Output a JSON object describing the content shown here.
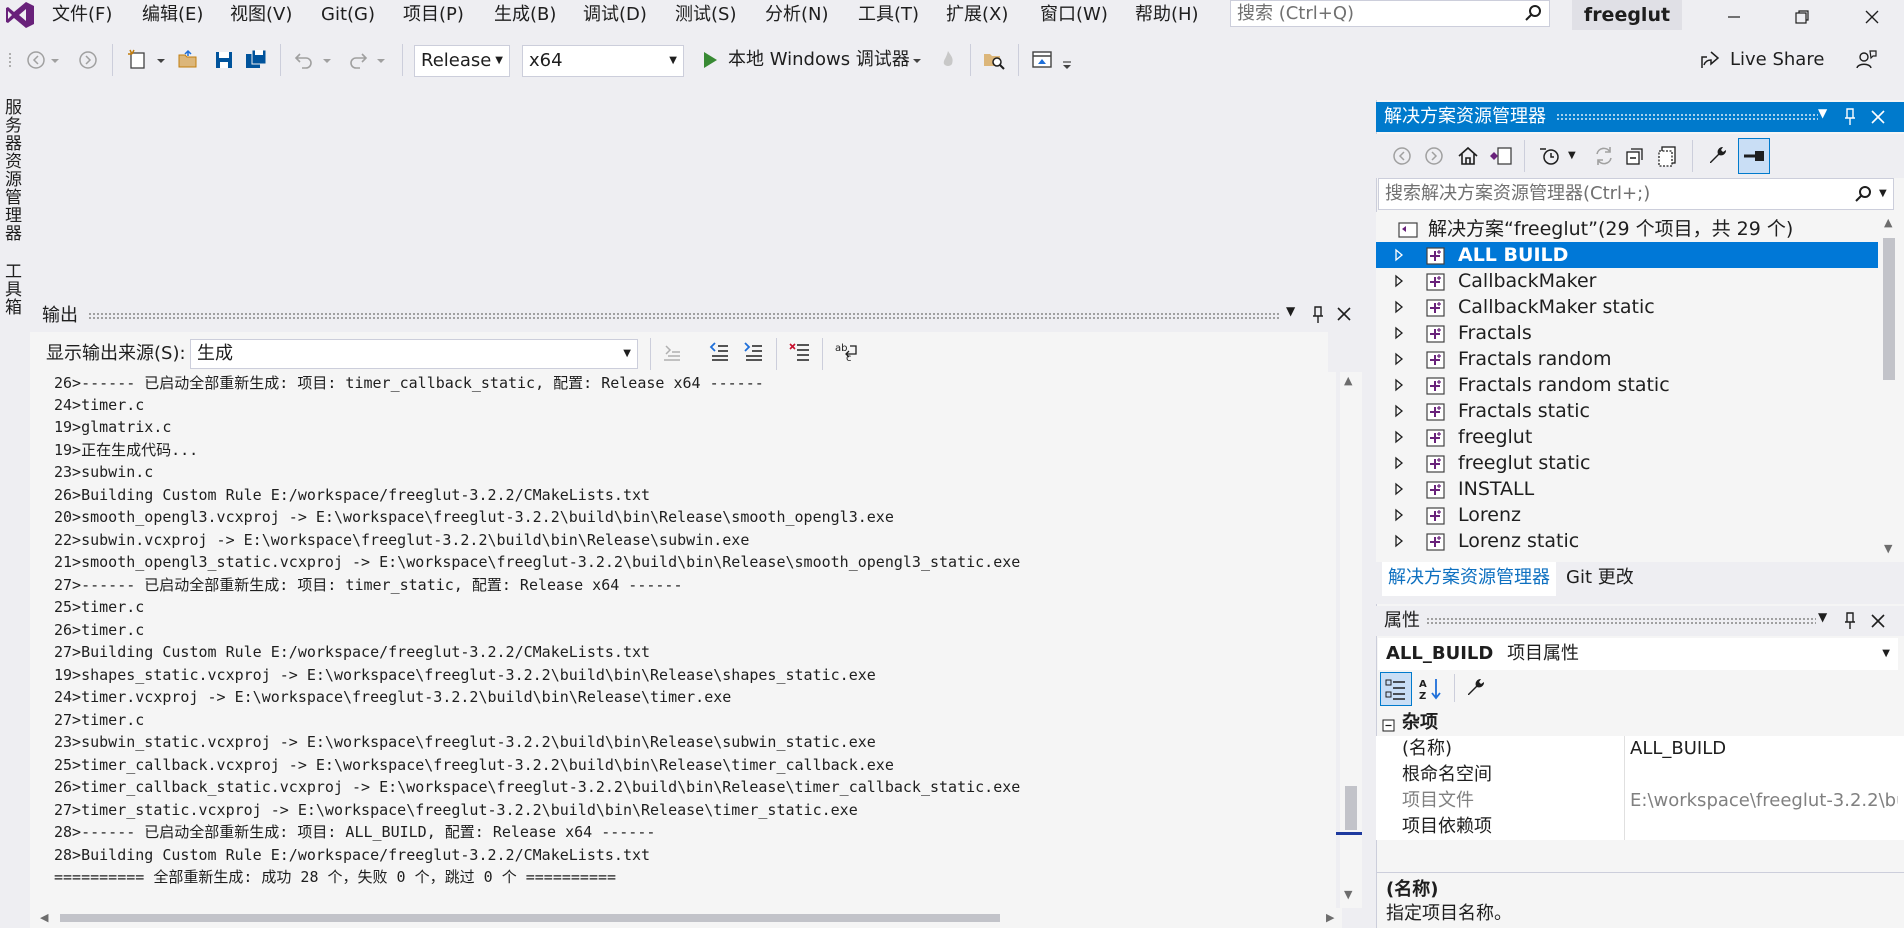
{
  "menu": {
    "items": [
      "文件(F)",
      "编辑(E)",
      "视图(V)",
      "Git(G)",
      "项目(P)",
      "生成(B)",
      "调试(D)",
      "测试(S)",
      "分析(N)",
      "工具(T)",
      "扩展(X)",
      "窗口(W)",
      "帮助(H)"
    ],
    "search_placeholder": "搜索 (Ctrl+Q)",
    "solution_badge": "freeglut"
  },
  "toolbar": {
    "configuration": "Release",
    "platform": "x64",
    "run_label": "本地 Windows 调试器",
    "live_share": "Live Share"
  },
  "left_tabs": {
    "server_explorer": "服务器资源管理器",
    "toolbox": "工具箱"
  },
  "output": {
    "title": "输出",
    "source_label": "显示输出来源(S):",
    "source_value": "生成",
    "lines": [
      "26>------ 已启动全部重新生成: 项目: timer_callback_static, 配置: Release x64 ------",
      "24>timer.c",
      "19>glmatrix.c",
      "19>正在生成代码...",
      "23>subwin.c",
      "26>Building Custom Rule E:/workspace/freeglut-3.2.2/CMakeLists.txt",
      "20>smooth_opengl3.vcxproj -> E:\\workspace\\freeglut-3.2.2\\build\\bin\\Release\\smooth_opengl3.exe",
      "22>subwin.vcxproj -> E:\\workspace\\freeglut-3.2.2\\build\\bin\\Release\\subwin.exe",
      "21>smooth_opengl3_static.vcxproj -> E:\\workspace\\freeglut-3.2.2\\build\\bin\\Release\\smooth_opengl3_static.exe",
      "27>------ 已启动全部重新生成: 项目: timer_static, 配置: Release x64 ------",
      "25>timer.c",
      "26>timer.c",
      "27>Building Custom Rule E:/workspace/freeglut-3.2.2/CMakeLists.txt",
      "19>shapes_static.vcxproj -> E:\\workspace\\freeglut-3.2.2\\build\\bin\\Release\\shapes_static.exe",
      "24>timer.vcxproj -> E:\\workspace\\freeglut-3.2.2\\build\\bin\\Release\\timer.exe",
      "27>timer.c",
      "23>subwin_static.vcxproj -> E:\\workspace\\freeglut-3.2.2\\build\\bin\\Release\\subwin_static.exe",
      "25>timer_callback.vcxproj -> E:\\workspace\\freeglut-3.2.2\\build\\bin\\Release\\timer_callback.exe",
      "26>timer_callback_static.vcxproj -> E:\\workspace\\freeglut-3.2.2\\build\\bin\\Release\\timer_callback_static.exe",
      "27>timer_static.vcxproj -> E:\\workspace\\freeglut-3.2.2\\build\\bin\\Release\\timer_static.exe",
      "28>------ 已启动全部重新生成: 项目: ALL_BUILD, 配置: Release x64 ------",
      "28>Building Custom Rule E:/workspace/freeglut-3.2.2/CMakeLists.txt",
      "========== 全部重新生成: 成功 28 个，失败 0 个，跳过 0 个 =========="
    ]
  },
  "solution_explorer": {
    "title": "解决方案资源管理器",
    "search_placeholder": "搜索解决方案资源管理器(Ctrl+;)",
    "solution_label": "解决方案“freeglut”(29 个项目，共 29 个)",
    "projects": [
      "ALL BUILD",
      "CallbackMaker",
      "CallbackMaker static",
      "Fractals",
      "Fractals random",
      "Fractals random static",
      "Fractals static",
      "freeglut",
      "freeglut static",
      "INSTALL",
      "Lorenz",
      "Lorenz static"
    ],
    "selected_index": 0,
    "tabs": [
      "解决方案资源管理器",
      "Git 更改"
    ]
  },
  "properties": {
    "title": "属性",
    "object_name": "ALL_BUILD",
    "object_type": "项目属性",
    "category": "杂项",
    "rows": [
      {
        "name": "(名称)",
        "value": "ALL_BUILD"
      },
      {
        "name": "根命名空间",
        "value": ""
      },
      {
        "name": "项目文件",
        "value": "E:\\workspace\\freeglut-3.2.2\\bu"
      },
      {
        "name": "项目依赖项",
        "value": ""
      }
    ],
    "description_title": "(名称)",
    "description_text": "指定项目名称。"
  },
  "colors": {
    "accent": "#007acc",
    "selection": "#0078d7",
    "vs_purple": "#68217a",
    "run_green": "#388a34"
  }
}
